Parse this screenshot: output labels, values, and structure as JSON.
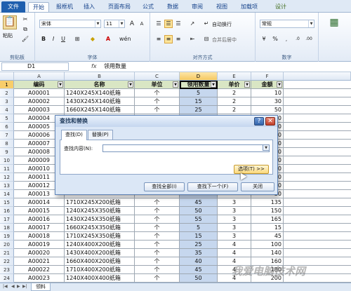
{
  "ribbon_tabs": [
    "文件",
    "开始",
    "报框机",
    "插入",
    "页面布局",
    "公式",
    "数据",
    "审阅",
    "视图",
    "加载项",
    "设计"
  ],
  "ribbon": {
    "paste": "粘贴",
    "clipboard_group": "剪贴板",
    "font_name": "宋体",
    "font_size": "11",
    "font_group": "字体",
    "wrap_text": "自动换行",
    "merge_center": "合并后居中",
    "align_group": "对齐方式",
    "number_format": "常规",
    "number_group": "数字"
  },
  "formula_bar": {
    "name_box": "D1",
    "fx": "fx",
    "content": "领用数量"
  },
  "columns": [
    "A",
    "B",
    "C",
    "D",
    "E",
    "F"
  ],
  "header_row": [
    "编码",
    "名称",
    "单位",
    "领用数量",
    "单价",
    "金额"
  ],
  "rows": [
    [
      "A00001",
      "1240X245X140纸箱",
      "个",
      "5",
      "2",
      "10"
    ],
    [
      "A00002",
      "1430X245X140纸箱",
      "个",
      "15",
      "2",
      "30"
    ],
    [
      "A00003",
      "1660X245X140纸箱",
      "个",
      "25",
      "2",
      "50"
    ],
    [
      "A00004",
      "",
      "",
      "",
      "",
      "50"
    ],
    [
      "A00005",
      "",
      "",
      "",
      "",
      "50"
    ],
    [
      "A00006",
      "",
      "",
      "",
      "",
      "50"
    ],
    [
      "A00007",
      "",
      "",
      "",
      "",
      "50"
    ],
    [
      "A00008",
      "",
      "",
      "",
      "",
      "50"
    ],
    [
      "A00009",
      "",
      "",
      "",
      "",
      "50"
    ],
    [
      "A00010",
      "",
      "",
      "",
      "",
      "50"
    ],
    [
      "A00011",
      "",
      "",
      "",
      "",
      "50"
    ],
    [
      "A00012",
      "",
      "",
      "",
      "",
      "50"
    ],
    [
      "A00013",
      "",
      "",
      "",
      "",
      "50"
    ],
    [
      "A00014",
      "1710X245X200纸箱",
      "个",
      "45",
      "3",
      "135"
    ],
    [
      "A00015",
      "1240X245X350纸箱",
      "个",
      "50",
      "3",
      "150"
    ],
    [
      "A00016",
      "1430X245X350纸箱",
      "个",
      "55",
      "3",
      "165"
    ],
    [
      "A00017",
      "1660X245X350纸箱",
      "个",
      "5",
      "3",
      "15"
    ],
    [
      "A00018",
      "1710X245X350纸箱",
      "个",
      "15",
      "3",
      "45"
    ],
    [
      "A00019",
      "1240X400X200纸箱",
      "个",
      "25",
      "4",
      "100"
    ],
    [
      "A00020",
      "1430X400X200纸箱",
      "个",
      "35",
      "4",
      "140"
    ],
    [
      "A00021",
      "1660X400X200纸箱",
      "个",
      "40",
      "4",
      "160"
    ],
    [
      "A00022",
      "1710X400X200纸箱",
      "个",
      "45",
      "4",
      "180"
    ],
    [
      "A00023",
      "1240X400X400纸箱",
      "个",
      "50",
      "4",
      "200"
    ],
    [
      "A00024",
      "1430X400X400纸箱",
      "个",
      "55",
      "4",
      "220"
    ]
  ],
  "sheet_tab": "领料",
  "dialog": {
    "title": "查找和替换",
    "tab_find": "查找(D)",
    "tab_replace": "替换(P)",
    "find_label": "查找内容(N):",
    "find_value": "",
    "options_btn": "选项(T) >>",
    "find_all_btn": "查找全部(I)",
    "find_next_btn": "查找下一个(F)",
    "close_btn": "关闭"
  },
  "watermark": "我爱电脑技术网"
}
